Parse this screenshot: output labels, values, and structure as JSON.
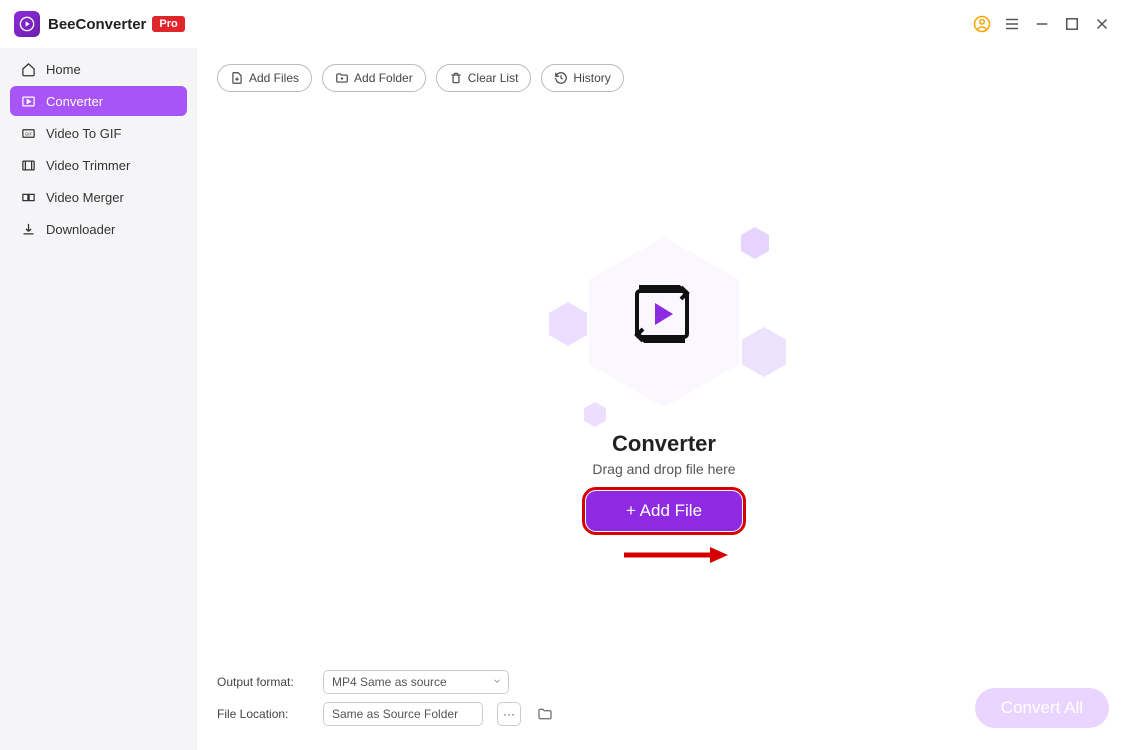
{
  "app": {
    "title": "BeeConverter",
    "badge": "Pro"
  },
  "sidebar": {
    "items": [
      {
        "label": "Home"
      },
      {
        "label": "Converter"
      },
      {
        "label": "Video To GIF"
      },
      {
        "label": "Video Trimmer"
      },
      {
        "label": "Video Merger"
      },
      {
        "label": "Downloader"
      }
    ]
  },
  "toolbar": {
    "add_files": "Add Files",
    "add_folder": "Add Folder",
    "clear_list": "Clear List",
    "history": "History"
  },
  "center": {
    "title": "Converter",
    "subtitle": "Drag and drop file here",
    "add_file_btn": "+ Add File"
  },
  "bottom": {
    "output_format_label": "Output format:",
    "output_format_value": "MP4 Same as source",
    "file_location_label": "File Location:",
    "file_location_value": "Same as Source Folder",
    "more_btn": "···"
  },
  "convert_all": "Convert All"
}
